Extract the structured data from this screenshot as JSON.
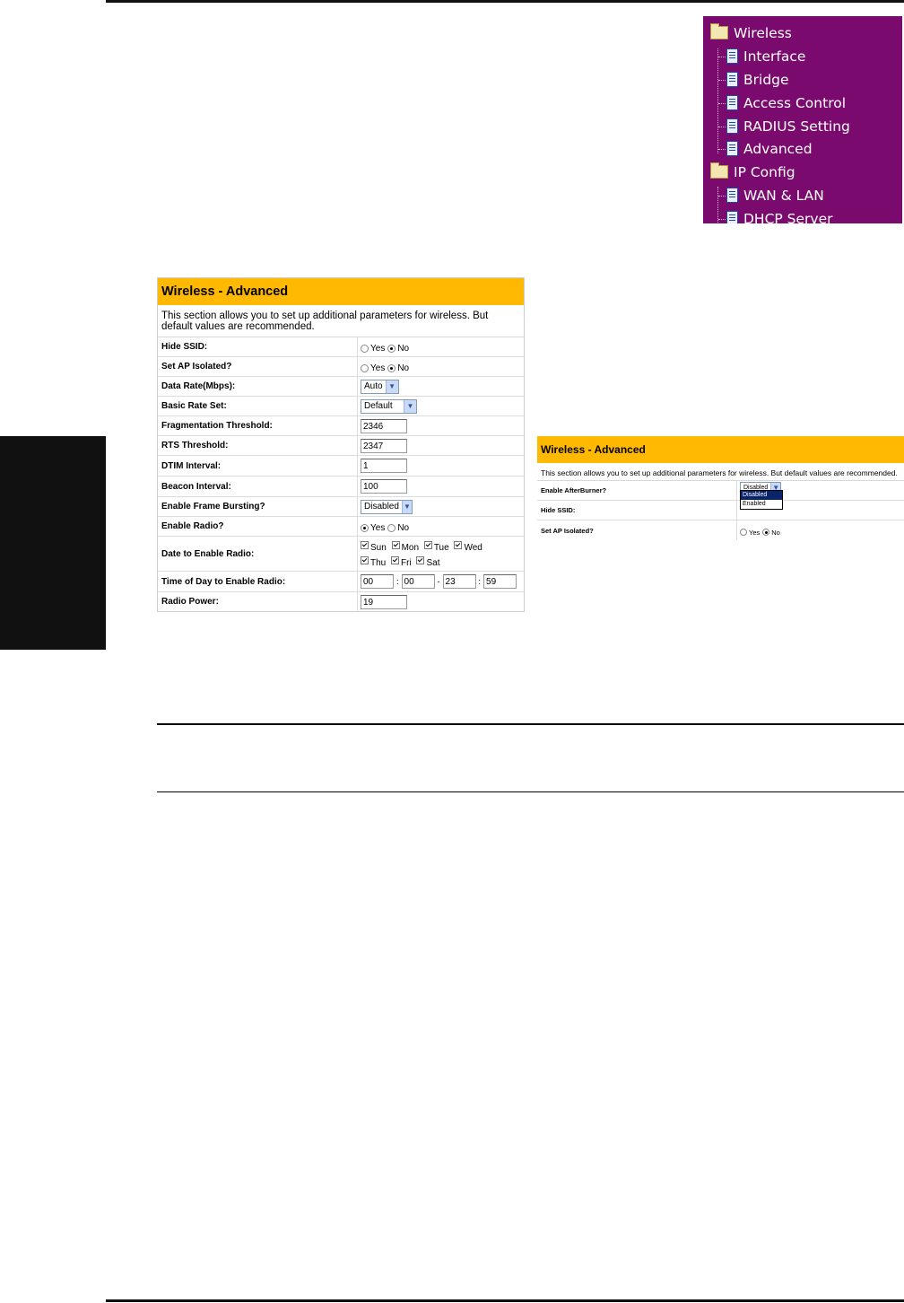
{
  "menu": {
    "items": [
      {
        "label": "Wireless",
        "type": "folder"
      },
      {
        "label": "Interface",
        "type": "page"
      },
      {
        "label": "Bridge",
        "type": "page"
      },
      {
        "label": "Access Control",
        "type": "page"
      },
      {
        "label": "RADIUS Setting",
        "type": "page"
      },
      {
        "label": "Advanced",
        "type": "page"
      },
      {
        "label": "IP Config",
        "type": "folder"
      },
      {
        "label": "WAN & LAN",
        "type": "page"
      },
      {
        "label": "DHCP Server",
        "type": "page"
      }
    ],
    "background": "#7b0a6e"
  },
  "form_main": {
    "title": "Wireless - Advanced",
    "description": "This section allows you to set up additional parameters for wireless. But default values are recommended.",
    "fields": {
      "hide_ssid": {
        "label": "Hide SSID:",
        "yes": "Yes",
        "no": "No",
        "selected": "No"
      },
      "ap_isolated": {
        "label": "Set AP Isolated?",
        "yes": "Yes",
        "no": "No",
        "selected": "No"
      },
      "data_rate": {
        "label": "Data Rate(Mbps):",
        "value": "Auto"
      },
      "basic_rate": {
        "label": "Basic Rate Set:",
        "value": "Default"
      },
      "frag": {
        "label": "Fragmentation Threshold:",
        "value": "2346"
      },
      "rts": {
        "label": "RTS Threshold:",
        "value": "2347"
      },
      "dtim": {
        "label": "DTIM Interval:",
        "value": "1"
      },
      "beacon": {
        "label": "Beacon Interval:",
        "value": "100"
      },
      "bursting": {
        "label": "Enable Frame Bursting?",
        "value": "Disabled"
      },
      "radio": {
        "label": "Enable Radio?",
        "yes": "Yes",
        "no": "No",
        "selected": "Yes"
      },
      "days": {
        "label": "Date to Enable Radio:",
        "sun": "Sun",
        "mon": "Mon",
        "tue": "Tue",
        "wed": "Wed",
        "thu": "Thu",
        "fri": "Fri",
        "sat": "Sat"
      },
      "time": {
        "label": "Time of Day to Enable Radio:",
        "h1": "00",
        "m1": "00",
        "h2": "23",
        "m2": "59"
      },
      "power": {
        "label": "Radio Power:",
        "value": "19"
      }
    },
    "accent": "#ffb900"
  },
  "form_small": {
    "title": "Wireless - Advanced",
    "description": "This section allows you to set up additional parameters for wireless. But default values are recommended.",
    "afterburner": {
      "label": "Enable AfterBurner?",
      "value": "Disabled",
      "options": [
        "Disabled",
        "Enabled"
      ]
    },
    "hide_ssid": {
      "label": "Hide SSID:"
    },
    "ap_isolated": {
      "label": "Set AP Isolated?",
      "yes": "Yes",
      "no": "No",
      "selected": "No"
    }
  }
}
